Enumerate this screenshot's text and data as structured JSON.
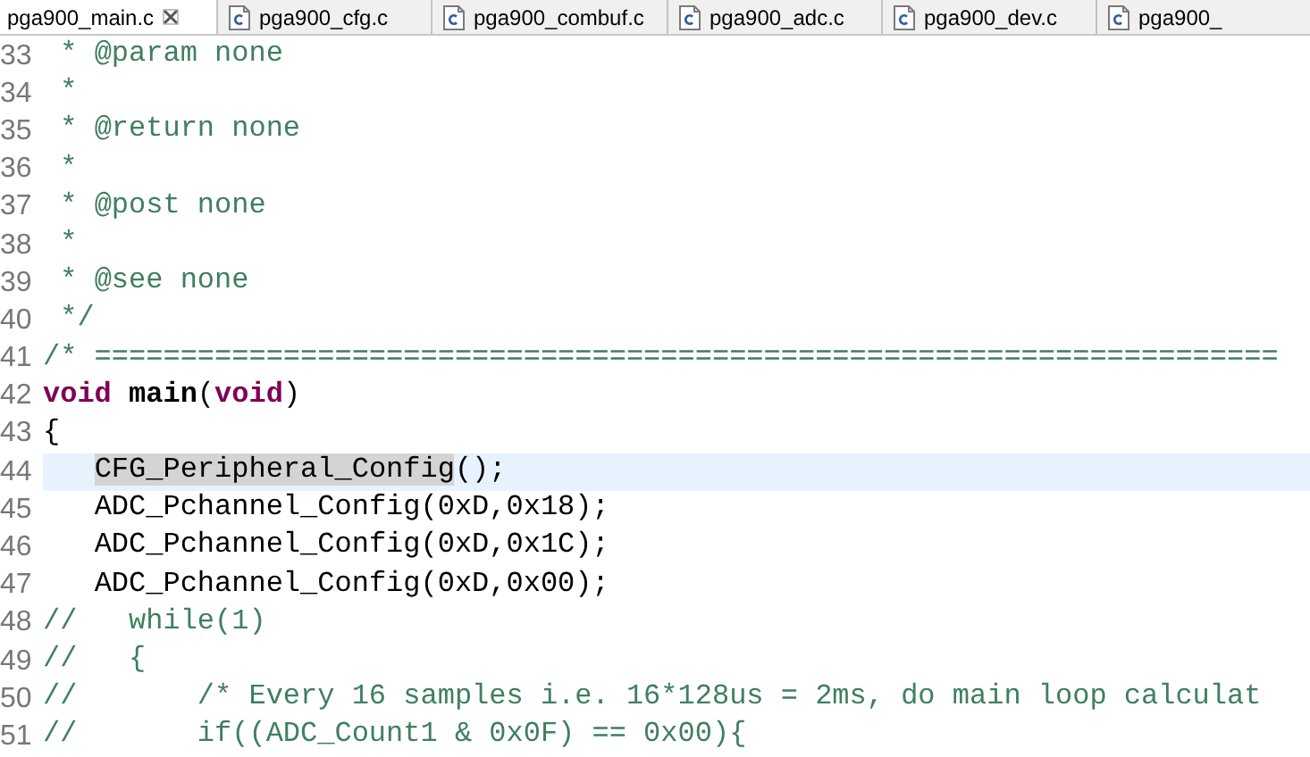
{
  "tabs": [
    {
      "label": "pga900_main.c",
      "selected": true
    },
    {
      "label": "pga900_cfg.c",
      "selected": false
    },
    {
      "label": "pga900_combuf.c",
      "selected": false
    },
    {
      "label": "pga900_adc.c",
      "selected": false
    },
    {
      "label": "pga900_dev.c",
      "selected": false
    },
    {
      "label": "pga900_",
      "selected": false
    }
  ],
  "editor": {
    "lines": [
      {
        "number": "33",
        "current": false,
        "segments": [
          {
            "kind": "comment",
            "text": " * @param none"
          }
        ]
      },
      {
        "number": "34",
        "current": false,
        "segments": [
          {
            "kind": "comment",
            "text": " *"
          }
        ]
      },
      {
        "number": "35",
        "current": false,
        "segments": [
          {
            "kind": "comment",
            "text": " * @return none"
          }
        ]
      },
      {
        "number": "36",
        "current": false,
        "segments": [
          {
            "kind": "comment",
            "text": " *"
          }
        ]
      },
      {
        "number": "37",
        "current": false,
        "segments": [
          {
            "kind": "comment",
            "text": " * @post none"
          }
        ]
      },
      {
        "number": "38",
        "current": false,
        "segments": [
          {
            "kind": "comment",
            "text": " *"
          }
        ]
      },
      {
        "number": "39",
        "current": false,
        "segments": [
          {
            "kind": "comment",
            "text": " * @see none"
          }
        ]
      },
      {
        "number": "40",
        "current": false,
        "segments": [
          {
            "kind": "comment",
            "text": " */"
          }
        ]
      },
      {
        "number": "41",
        "current": false,
        "segments": [
          {
            "kind": "comment",
            "text": "/* ====================================================================="
          }
        ]
      },
      {
        "number": "42",
        "current": false,
        "segments": [
          {
            "kind": "keyword",
            "text": "void"
          },
          {
            "kind": "declaration",
            "text": " main"
          },
          {
            "kind": "code",
            "text": "("
          },
          {
            "kind": "keyword",
            "text": "void"
          },
          {
            "kind": "code",
            "text": ")"
          }
        ]
      },
      {
        "number": "43",
        "current": false,
        "segments": [
          {
            "kind": "code",
            "text": "{"
          }
        ]
      },
      {
        "number": "44",
        "current": true,
        "segments": [
          {
            "kind": "occurrence",
            "text": "   CFG_Peripheral_Config"
          },
          {
            "kind": "code",
            "text": "();"
          }
        ]
      },
      {
        "number": "45",
        "current": false,
        "segments": [
          {
            "kind": "code",
            "text": "   ADC_Pchannel_Config(0xD,0x18);"
          }
        ]
      },
      {
        "number": "46",
        "current": false,
        "segments": [
          {
            "kind": "code",
            "text": "   ADC_Pchannel_Config(0xD,0x1C);"
          }
        ]
      },
      {
        "number": "47",
        "current": false,
        "segments": [
          {
            "kind": "code",
            "text": "   ADC_Pchannel_Config(0xD,0x00);"
          }
        ]
      },
      {
        "number": "48",
        "current": false,
        "segments": [
          {
            "kind": "comment",
            "text": "//   while(1)"
          }
        ]
      },
      {
        "number": "49",
        "current": false,
        "segments": [
          {
            "kind": "comment",
            "text": "//   {"
          }
        ]
      },
      {
        "number": "50",
        "current": false,
        "segments": [
          {
            "kind": "comment",
            "text": "//       /* Every 16 samples i.e. 16*128us = 2ms, do main loop calculat"
          }
        ]
      },
      {
        "number": "51",
        "current": false,
        "segments": [
          {
            "kind": "comment",
            "text": "//       if((ADC_Count1 & 0x0F) == 0x00){"
          }
        ]
      }
    ]
  }
}
